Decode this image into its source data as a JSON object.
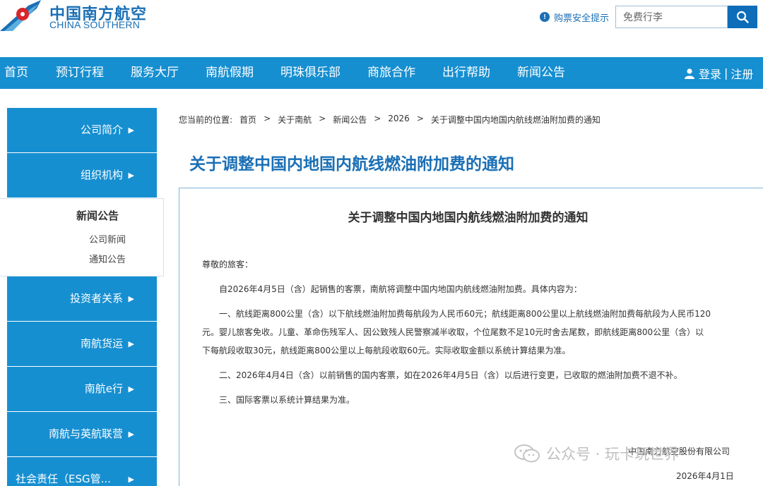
{
  "brand": {
    "name_cn": "中国南方航空",
    "name_en": "CHINA SOUTHERN"
  },
  "header": {
    "safety_tip": "购票安全提示",
    "search": {
      "value": "免费行李"
    }
  },
  "nav": {
    "items": [
      "首页",
      "预订行程",
      "服务大厅",
      "南航假期",
      "明珠俱乐部",
      "商旅合作",
      "出行帮助",
      "新闻公告"
    ],
    "login": "登录",
    "divider": "|",
    "register": "注册"
  },
  "sidebar": {
    "items_top": [
      "公司简介",
      "组织机构"
    ],
    "active": {
      "title": "新闻公告",
      "sub": [
        "公司新闻",
        "通知公告"
      ]
    },
    "items_bottom": [
      "投资者关系",
      "南航货运",
      "南航e行",
      "南航与英航联营",
      "社会责任（ESG管..."
    ]
  },
  "breadcrumb": {
    "prefix": "您当前的位置:",
    "items": [
      "首页",
      "关于南航",
      "新闻公告",
      "2026",
      "关于调整中国内地国内航线燃油附加费的通知"
    ],
    "sep": ">"
  },
  "page_title": "关于调整中国内地国内航线燃油附加费的通知",
  "article": {
    "title": "关于调整中国内地国内航线燃油附加费的通知",
    "greeting": "尊敬的旅客：",
    "intro": "自2026年4月5日（含）起销售的客票，南航将调整中国内地国内航线燃油附加费。具体内容为：",
    "p1_l1": "一、航线距离800公里（含）以下航线燃油附加费每航段为人民币60元；航线距离800公里以上航线燃油附加费每航段为人民币120",
    "p1_l2": "元。婴儿旅客免收。儿童、革命伤残军人、因公致残人民警察减半收取，个位尾数不足10元时舍去尾数，即航线距离800公里（含）以",
    "p1_l3": "下每航段收取30元，航线距离800公里以上每航段收取60元。实际收取金额以系统计算结果为准。",
    "p2": "二、2026年4月4日（含）以前销售的国内客票，如在2026年4月5日（含）以后进行变更，已收取的燃油附加费不退不补。",
    "p3": "三、国际客票以系统计算结果为准。",
    "signature": "中国南方航空股份有限公司",
    "date": "2026年4月1日"
  },
  "watermark": {
    "text": "公众号 · 玩卡玩世界"
  },
  "colors": {
    "brand_blue": "#168fd1",
    "title_blue": "#1a6fb5"
  }
}
